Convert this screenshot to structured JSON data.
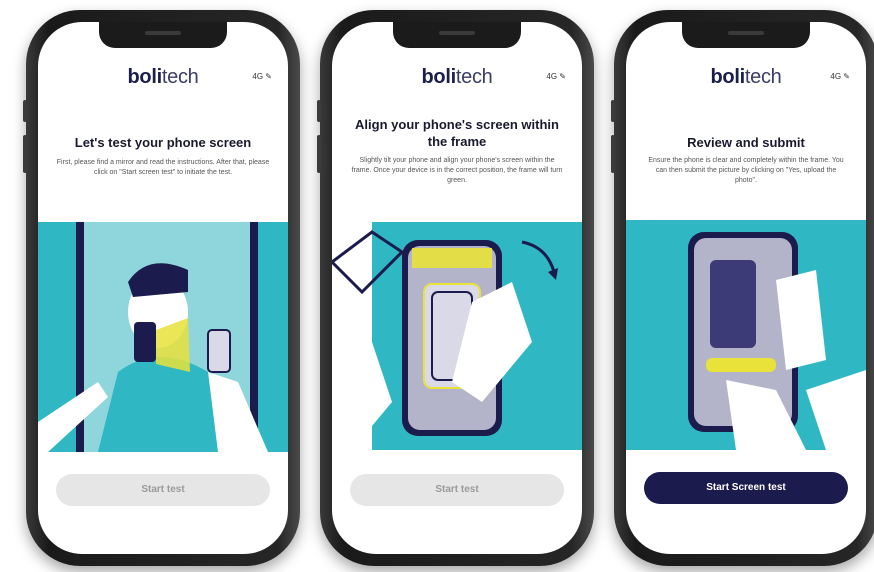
{
  "brand": {
    "bold": "boli",
    "light": "tech"
  },
  "status_text": "4G ✎",
  "screens": [
    {
      "title": "Let's test your phone screen",
      "description": "First, please find a mirror and read the instructions. After that, please click on \"Start screen test\" to initiate the test.",
      "button": "Start test",
      "button_state": "disabled"
    },
    {
      "title": "Align your phone's screen within the frame",
      "description": "Slightly tilt your phone and align your phone's screen within the frame. Once your device is in the correct position, the frame will turn green.",
      "button": "Start test",
      "button_state": "disabled"
    },
    {
      "title": "Review and submit",
      "description": "Ensure the phone is clear and completely within the frame. You can then submit the picture by clicking on \"Yes, upload the photo\".",
      "button": "Start Screen test",
      "button_state": "active"
    }
  ],
  "colors": {
    "teal": "#2fb8c4",
    "navy": "#1b1b4d",
    "yellow": "#e8e23a",
    "disabled_button": "#e6e6e6"
  }
}
